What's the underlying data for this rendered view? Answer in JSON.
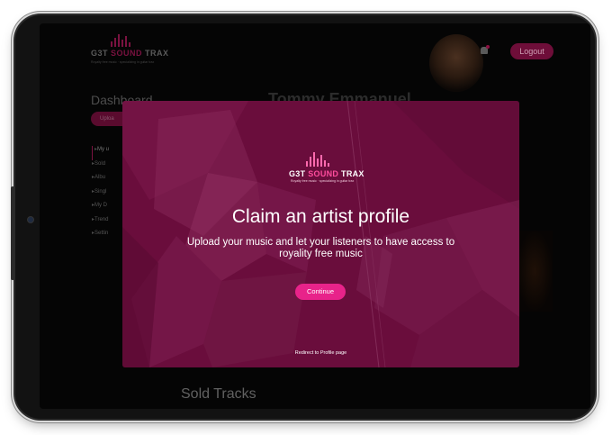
{
  "background_app": {
    "logo": {
      "brand_prefix": "G3T ",
      "brand_mid": "SOUND",
      "brand_suffix": " TRAX",
      "tagline": "Royalty free music · specializing in guitar trax"
    },
    "logout_label": "Logout",
    "dashboard_title": "Dashboard",
    "upload_label": "Uploa",
    "menu_items": [
      "My u",
      "Sold",
      "Albu",
      "Singl",
      "My D",
      "Trend",
      "Settin"
    ],
    "artist_name": "Tommy Emmanuel",
    "sold_tracks_heading": "Sold Tracks"
  },
  "modal": {
    "logo": {
      "brand_prefix": "G3T ",
      "brand_mid": "SOUND",
      "brand_suffix": " TRAX",
      "tagline": "Royalty free music · specializing in guitar trax"
    },
    "title": "Claim an artist profile",
    "description": "Upload your music and let your listeners to have access to royality free music",
    "continue_label": "Continue",
    "redirect_text": "Redirect to Profile page"
  },
  "colors": {
    "modal_bg": "#6a0d3c",
    "accent": "#e8238a",
    "logout_bg": "#6e0e39"
  }
}
